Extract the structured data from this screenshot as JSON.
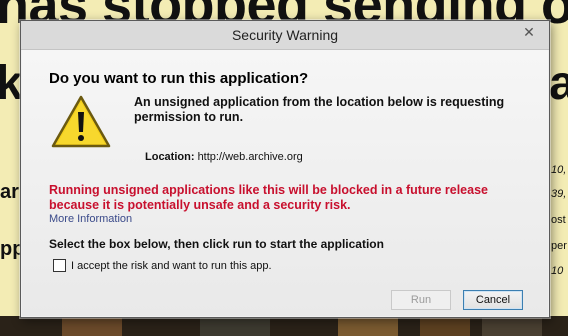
{
  "background": {
    "headline": "has stopped sending out",
    "headline_fragment": "k",
    "headline_fragment_right": "a",
    "left_fragments": [
      "ar",
      "pp"
    ],
    "right_fragments": [
      "10,",
      "39,",
      "ost",
      "per",
      "10"
    ]
  },
  "dialog": {
    "title": "Security Warning",
    "question": "Do you want to run this application?",
    "description": "An unsigned application from the location below is requesting permission to run.",
    "location_label": "Location:",
    "location_value": "http://web.archive.org",
    "red_warning": "Running unsigned applications like this will be blocked in a future release because it is potentially unsafe and a security risk.",
    "more_info": "More Information",
    "instruction": "Select the box below, then click run to start the application",
    "accept_checkbox_label": "I accept the risk and want to run this app.",
    "accept_checked": false,
    "run_label": "Run",
    "run_enabled": false,
    "cancel_label": "Cancel",
    "close_icon": "close-icon",
    "warning_icon": "warning-triangle-icon"
  },
  "colors": {
    "warning_text": "#c8102e",
    "link": "#3a4a8a",
    "cancel_border": "#3c7fb1",
    "icon_yellow": "#f4cf1b"
  }
}
